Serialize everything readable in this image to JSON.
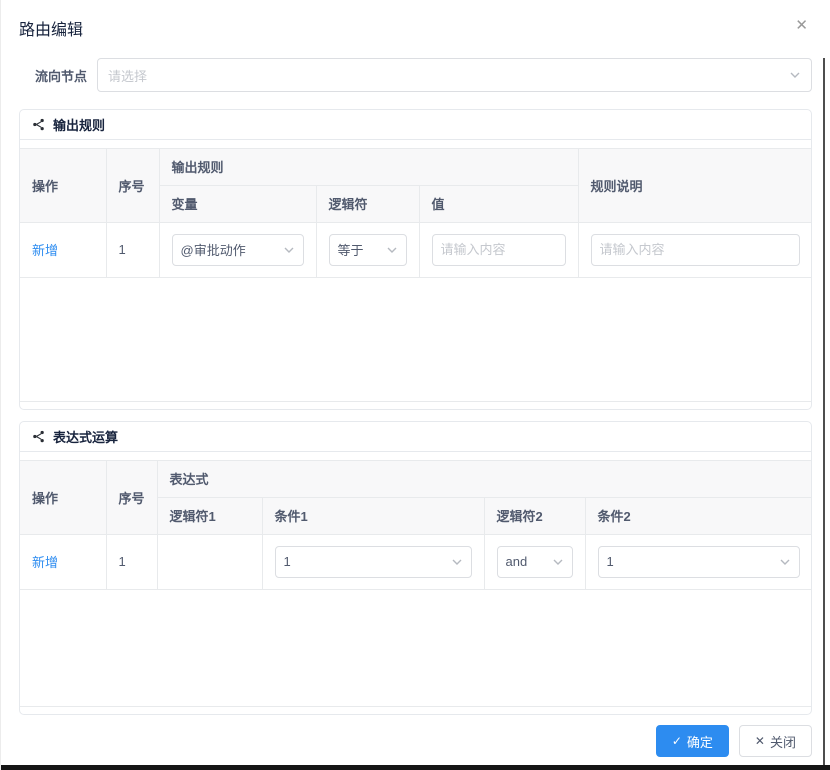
{
  "dialog": {
    "title": "路由编辑"
  },
  "icons": {
    "dialog_close": "✕",
    "confirm_check": "✓",
    "close_x": "✕"
  },
  "form": {
    "flow_node": {
      "label": "流向节点",
      "placeholder": "请选择"
    }
  },
  "output_rules": {
    "title": "输出规则",
    "headers": {
      "operation": "操作",
      "index": "序号",
      "group": "输出规则",
      "variable": "变量",
      "logic": "逻辑符",
      "value": "值",
      "description": "规则说明"
    },
    "rows": [
      {
        "add": "新增",
        "index": "1",
        "variable": "@审批动作",
        "logic": "等于",
        "value_placeholder": "请输入内容",
        "description_placeholder": "请输入内容"
      }
    ]
  },
  "expression": {
    "title": "表达式运算",
    "headers": {
      "operation": "操作",
      "index": "序号",
      "group": "表达式",
      "logic1": "逻辑符1",
      "condition1": "条件1",
      "logic2": "逻辑符2",
      "condition2": "条件2"
    },
    "rows": [
      {
        "add": "新增",
        "index": "1",
        "logic1": "",
        "condition1": "1",
        "logic2": "and",
        "condition2": "1"
      }
    ]
  },
  "footer": {
    "confirm": "确定",
    "close": "关闭"
  },
  "colors": {
    "primary": "#2d8cf0",
    "table_border": "#e8eaec",
    "header_bg": "#f8f8f9",
    "text": "#515a6e",
    "title_text": "#17233d",
    "placeholder": "#c5c8ce",
    "input_border": "#dcdee2"
  }
}
